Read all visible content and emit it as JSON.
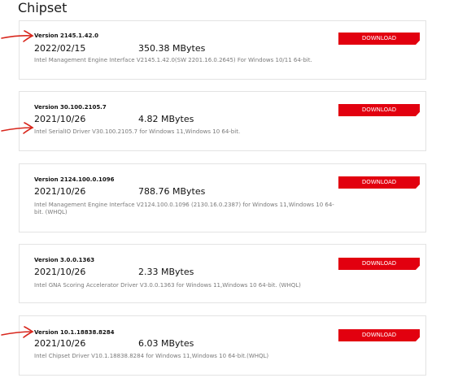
{
  "page": {
    "title": "Chipset"
  },
  "cards": [
    {
      "version": "Version 2145.1.42.0",
      "date": "2022/02/15",
      "size": "350.38 MBytes",
      "description": "Intel Management Engine Interface V2145.1.42.0(SW 2201.16.0.2645) For Windows 10/11 64-bit.",
      "download_label": "DOWNLOAD"
    },
    {
      "version": "Version 30.100.2105.7",
      "date": "2021/10/26",
      "size": "4.82 MBytes",
      "description": "Intel SerialIO Driver V30.100.2105.7 for Windows 11,Windows 10 64-bit.",
      "download_label": "DOWNLOAD"
    },
    {
      "version": "Version 2124.100.0.1096",
      "date": "2021/10/26",
      "size": "788.76 MBytes",
      "description": "Intel Management Engine Interface V2124.100.0.1096 (2130.16.0.2387) for Windows 11,Windows 10 64-bit. (WHQL)",
      "download_label": "DOWNLOAD"
    },
    {
      "version": "Version 3.0.0.1363",
      "date": "2021/10/26",
      "size": "2.33 MBytes",
      "description": "Intel GNA Scoring Accelerator Driver V3.0.0.1363 for Windows 11,Windows 10 64-bit. (WHQL)",
      "download_label": "DOWNLOAD"
    },
    {
      "version": "Version 10.1.18838.8284",
      "date": "2021/10/26",
      "size": "6.03 MBytes",
      "description": "Intel Chipset Driver V10.1.18838.8284 for Windows 11,Windows 10 64-bit.(WHQL)",
      "download_label": "DOWNLOAD"
    }
  ],
  "annotations": {
    "arrow_color": "#d8261c"
  },
  "colors": {
    "accent": "#e2000f",
    "card_border": "#e3e3e3",
    "description_text": "#7a7a7a"
  }
}
